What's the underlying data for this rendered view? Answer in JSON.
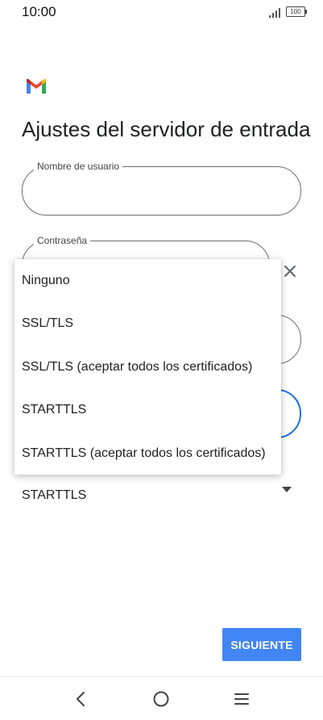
{
  "status_bar": {
    "time": "10:00",
    "battery": "100",
    "icons": [
      "signal-icon",
      "battery-icon"
    ]
  },
  "header": {
    "logo_icon": "gmail-logo",
    "title": "Ajustes del servidor de entrada"
  },
  "form": {
    "username_label": "Nombre de usuario",
    "username_value": "",
    "password_label": "Contraseña",
    "password_value": "",
    "security_selected": "STARTTLS"
  },
  "dropdown": {
    "options": [
      "Ninguno",
      "SSL/TLS",
      "SSL/TLS (aceptar todos los certificados)",
      "STARTTLS",
      "STARTTLS (aceptar todos los certificados)"
    ]
  },
  "actions": {
    "next_label": "SIGUIENTE"
  },
  "colors": {
    "accent": "#4285f4",
    "focus_border": "#1a73e8",
    "text": "#202124"
  },
  "nav_bar": {
    "icons": [
      "back-icon",
      "home-icon",
      "menu-icon"
    ]
  }
}
